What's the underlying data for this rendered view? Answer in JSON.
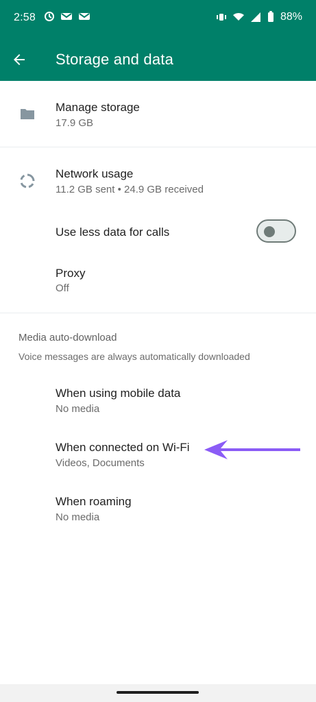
{
  "status": {
    "time": "2:58",
    "battery": "88%"
  },
  "appbar": {
    "title": "Storage and data"
  },
  "rows": {
    "manage_storage": {
      "title": "Manage storage",
      "subtitle": "17.9 GB"
    },
    "network_usage": {
      "title": "Network usage",
      "subtitle": "11.2 GB sent • 24.9 GB received"
    },
    "use_less_data": {
      "title": "Use less data for calls"
    },
    "proxy": {
      "title": "Proxy",
      "subtitle": "Off"
    }
  },
  "media_section": {
    "header": "Media auto-download",
    "note": "Voice messages are always automatically downloaded",
    "items": [
      {
        "title": "When using mobile data",
        "subtitle": "No media"
      },
      {
        "title": "When connected on Wi-Fi",
        "subtitle": "Videos, Documents"
      },
      {
        "title": "When roaming",
        "subtitle": "No media"
      }
    ]
  },
  "colors": {
    "primary": "#008069",
    "divider": "#e9edef",
    "annotation_arrow": "#8b5cf6"
  },
  "icons": {
    "back": "arrow-left-icon",
    "folder": "folder-icon",
    "network": "network-usage-icon"
  }
}
